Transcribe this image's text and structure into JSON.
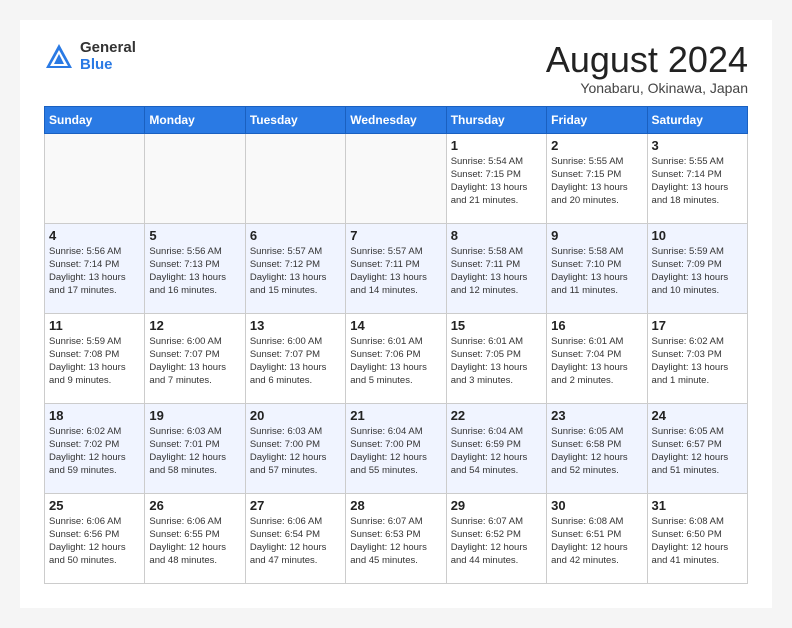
{
  "header": {
    "logo_general": "General",
    "logo_blue": "Blue",
    "title": "August 2024",
    "location": "Yonabaru, Okinawa, Japan"
  },
  "weekdays": [
    "Sunday",
    "Monday",
    "Tuesday",
    "Wednesday",
    "Thursday",
    "Friday",
    "Saturday"
  ],
  "weeks": [
    [
      {
        "day": "",
        "info": ""
      },
      {
        "day": "",
        "info": ""
      },
      {
        "day": "",
        "info": ""
      },
      {
        "day": "",
        "info": ""
      },
      {
        "day": "1",
        "info": "Sunrise: 5:54 AM\nSunset: 7:15 PM\nDaylight: 13 hours\nand 21 minutes."
      },
      {
        "day": "2",
        "info": "Sunrise: 5:55 AM\nSunset: 7:15 PM\nDaylight: 13 hours\nand 20 minutes."
      },
      {
        "day": "3",
        "info": "Sunrise: 5:55 AM\nSunset: 7:14 PM\nDaylight: 13 hours\nand 18 minutes."
      }
    ],
    [
      {
        "day": "4",
        "info": "Sunrise: 5:56 AM\nSunset: 7:14 PM\nDaylight: 13 hours\nand 17 minutes."
      },
      {
        "day": "5",
        "info": "Sunrise: 5:56 AM\nSunset: 7:13 PM\nDaylight: 13 hours\nand 16 minutes."
      },
      {
        "day": "6",
        "info": "Sunrise: 5:57 AM\nSunset: 7:12 PM\nDaylight: 13 hours\nand 15 minutes."
      },
      {
        "day": "7",
        "info": "Sunrise: 5:57 AM\nSunset: 7:11 PM\nDaylight: 13 hours\nand 14 minutes."
      },
      {
        "day": "8",
        "info": "Sunrise: 5:58 AM\nSunset: 7:11 PM\nDaylight: 13 hours\nand 12 minutes."
      },
      {
        "day": "9",
        "info": "Sunrise: 5:58 AM\nSunset: 7:10 PM\nDaylight: 13 hours\nand 11 minutes."
      },
      {
        "day": "10",
        "info": "Sunrise: 5:59 AM\nSunset: 7:09 PM\nDaylight: 13 hours\nand 10 minutes."
      }
    ],
    [
      {
        "day": "11",
        "info": "Sunrise: 5:59 AM\nSunset: 7:08 PM\nDaylight: 13 hours\nand 9 minutes."
      },
      {
        "day": "12",
        "info": "Sunrise: 6:00 AM\nSunset: 7:07 PM\nDaylight: 13 hours\nand 7 minutes."
      },
      {
        "day": "13",
        "info": "Sunrise: 6:00 AM\nSunset: 7:07 PM\nDaylight: 13 hours\nand 6 minutes."
      },
      {
        "day": "14",
        "info": "Sunrise: 6:01 AM\nSunset: 7:06 PM\nDaylight: 13 hours\nand 5 minutes."
      },
      {
        "day": "15",
        "info": "Sunrise: 6:01 AM\nSunset: 7:05 PM\nDaylight: 13 hours\nand 3 minutes."
      },
      {
        "day": "16",
        "info": "Sunrise: 6:01 AM\nSunset: 7:04 PM\nDaylight: 13 hours\nand 2 minutes."
      },
      {
        "day": "17",
        "info": "Sunrise: 6:02 AM\nSunset: 7:03 PM\nDaylight: 13 hours\nand 1 minute."
      }
    ],
    [
      {
        "day": "18",
        "info": "Sunrise: 6:02 AM\nSunset: 7:02 PM\nDaylight: 12 hours\nand 59 minutes."
      },
      {
        "day": "19",
        "info": "Sunrise: 6:03 AM\nSunset: 7:01 PM\nDaylight: 12 hours\nand 58 minutes."
      },
      {
        "day": "20",
        "info": "Sunrise: 6:03 AM\nSunset: 7:00 PM\nDaylight: 12 hours\nand 57 minutes."
      },
      {
        "day": "21",
        "info": "Sunrise: 6:04 AM\nSunset: 7:00 PM\nDaylight: 12 hours\nand 55 minutes."
      },
      {
        "day": "22",
        "info": "Sunrise: 6:04 AM\nSunset: 6:59 PM\nDaylight: 12 hours\nand 54 minutes."
      },
      {
        "day": "23",
        "info": "Sunrise: 6:05 AM\nSunset: 6:58 PM\nDaylight: 12 hours\nand 52 minutes."
      },
      {
        "day": "24",
        "info": "Sunrise: 6:05 AM\nSunset: 6:57 PM\nDaylight: 12 hours\nand 51 minutes."
      }
    ],
    [
      {
        "day": "25",
        "info": "Sunrise: 6:06 AM\nSunset: 6:56 PM\nDaylight: 12 hours\nand 50 minutes."
      },
      {
        "day": "26",
        "info": "Sunrise: 6:06 AM\nSunset: 6:55 PM\nDaylight: 12 hours\nand 48 minutes."
      },
      {
        "day": "27",
        "info": "Sunrise: 6:06 AM\nSunset: 6:54 PM\nDaylight: 12 hours\nand 47 minutes."
      },
      {
        "day": "28",
        "info": "Sunrise: 6:07 AM\nSunset: 6:53 PM\nDaylight: 12 hours\nand 45 minutes."
      },
      {
        "day": "29",
        "info": "Sunrise: 6:07 AM\nSunset: 6:52 PM\nDaylight: 12 hours\nand 44 minutes."
      },
      {
        "day": "30",
        "info": "Sunrise: 6:08 AM\nSunset: 6:51 PM\nDaylight: 12 hours\nand 42 minutes."
      },
      {
        "day": "31",
        "info": "Sunrise: 6:08 AM\nSunset: 6:50 PM\nDaylight: 12 hours\nand 41 minutes."
      }
    ]
  ]
}
